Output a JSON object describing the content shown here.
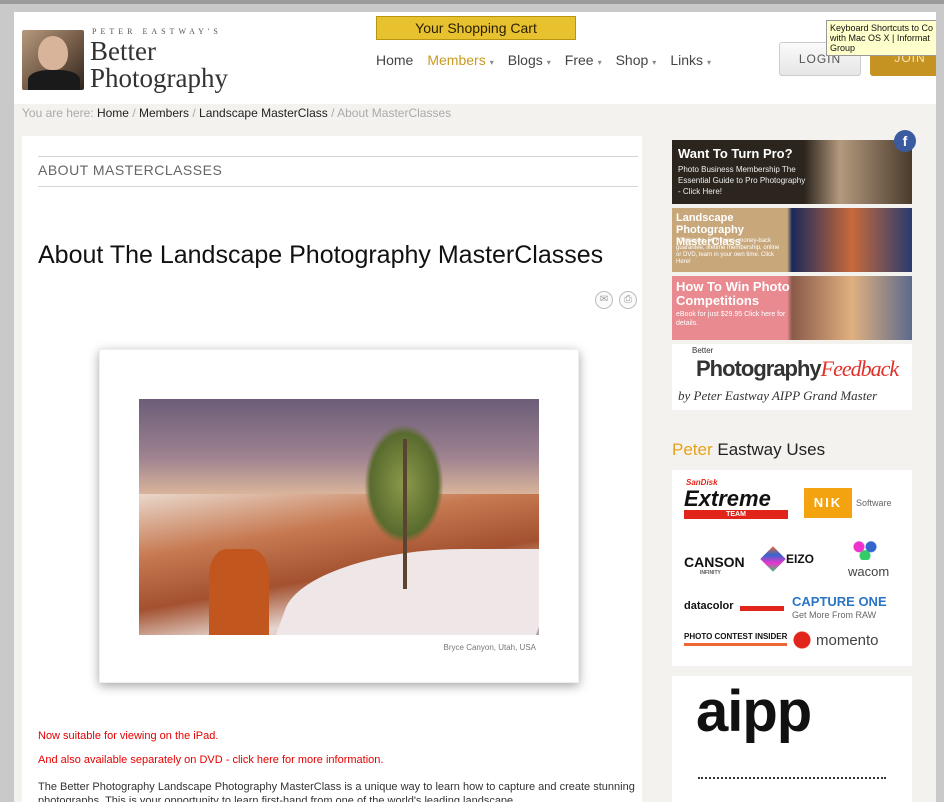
{
  "header": {
    "logo_small": "PETER EASTWAY'S",
    "logo_line1": "Better",
    "logo_line2": "Photography",
    "cart_label": "Your Shopping Cart",
    "nav": [
      {
        "label": "Home",
        "dropdown": false,
        "active": false
      },
      {
        "label": "Members",
        "dropdown": true,
        "active": true
      },
      {
        "label": "Blogs",
        "dropdown": true,
        "active": false
      },
      {
        "label": "Free",
        "dropdown": true,
        "active": false
      },
      {
        "label": "Shop",
        "dropdown": true,
        "active": false
      },
      {
        "label": "Links",
        "dropdown": true,
        "active": false
      }
    ],
    "login_label": "LOGIN",
    "join_label": "JOIN",
    "tooltip": "Keyboard Shortcuts to Co with Mac OS X | Informat Group"
  },
  "breadcrumb": {
    "prefix": "You are here:",
    "items": [
      "Home",
      "Members",
      "Landscape MasterClass"
    ],
    "current": "About MasterClasses"
  },
  "main": {
    "section_title": "ABOUT MASTERCLASSES",
    "page_title": "About The Landscape Photography MasterClasses",
    "email_icon": "email-icon",
    "print_icon": "print-icon",
    "photo_caption": "Bryce Canyon, Utah, USA",
    "notice_ipad": "Now suitable for viewing on the iPad.",
    "notice_dvd": "And also available separately on DVD - click here for more information.",
    "body": "The Better Photography Landscape Photography MasterClass is a unique way to learn how to capture and create stunning photographs. This is your opportunity to learn first-hand from one of the world's leading landscape"
  },
  "sidebar": {
    "ad1": {
      "heading": "Want To Turn Pro?",
      "sub": "Photo Business Membership The Essential Guide to Pro Photography - Click Here!"
    },
    "ad2": {
      "heading": "Landscape Photography MasterClass",
      "sub": "10 classes, 56 movies, money-back guarantee, lifetime membership, online or DVD, learn in your own time. Click Here!"
    },
    "ad3": {
      "heading": "How To Win Photo Competitions",
      "sub": "eBook for just $29.95 Click here for details."
    },
    "ad4": {
      "small": "Better",
      "brand": "Photography",
      "brand_em": "Feedback",
      "by": "by Peter Eastway AIPP Grand Master"
    },
    "uses_name": "Peter",
    "uses_rest": " Eastway Uses",
    "sponsors": {
      "sandisk_small": "SanDisk",
      "sandisk": "Extreme",
      "team": "TEAM",
      "nik": "NIK",
      "nik_software": "Software",
      "canson": "CANSON",
      "canson_small": "INFINITY",
      "eizo": "EIZO",
      "wacom": "wacom",
      "datacolor": "datacolor",
      "capture_one": "CAPTURE ONE",
      "capture_tag": "Get More From RAW",
      "contest": "PHOTO CONTEST INSIDER",
      "momento": "momento"
    },
    "aipp": "aipp",
    "facebook": "f"
  }
}
